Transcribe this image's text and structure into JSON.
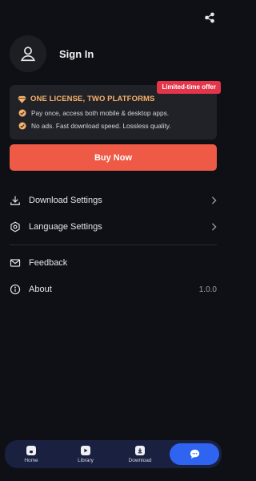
{
  "header": {
    "share_icon": "share-icon"
  },
  "profile": {
    "avatar_icon": "user-icon",
    "signin_label": "Sign In"
  },
  "promo": {
    "badge": "Limited-time offer",
    "title": "ONE LICENSE, TWO PLATFORMS",
    "points": [
      "Pay once, access both mobile & desktop apps.",
      "No ads. Fast download speed. Lossless quality."
    ],
    "colors": {
      "accent": "#f8b26a",
      "badge": "#e5354a"
    }
  },
  "buy": {
    "label": "Buy Now",
    "color": "#ee5a45"
  },
  "menu": {
    "download_settings": "Download Settings",
    "language_settings": "Language Settings",
    "feedback": "Feedback",
    "about": "About",
    "version": "1.0.0"
  },
  "nav": {
    "home": "Home",
    "library": "Library",
    "download": "Download",
    "chat_icon": "chat-icon"
  }
}
